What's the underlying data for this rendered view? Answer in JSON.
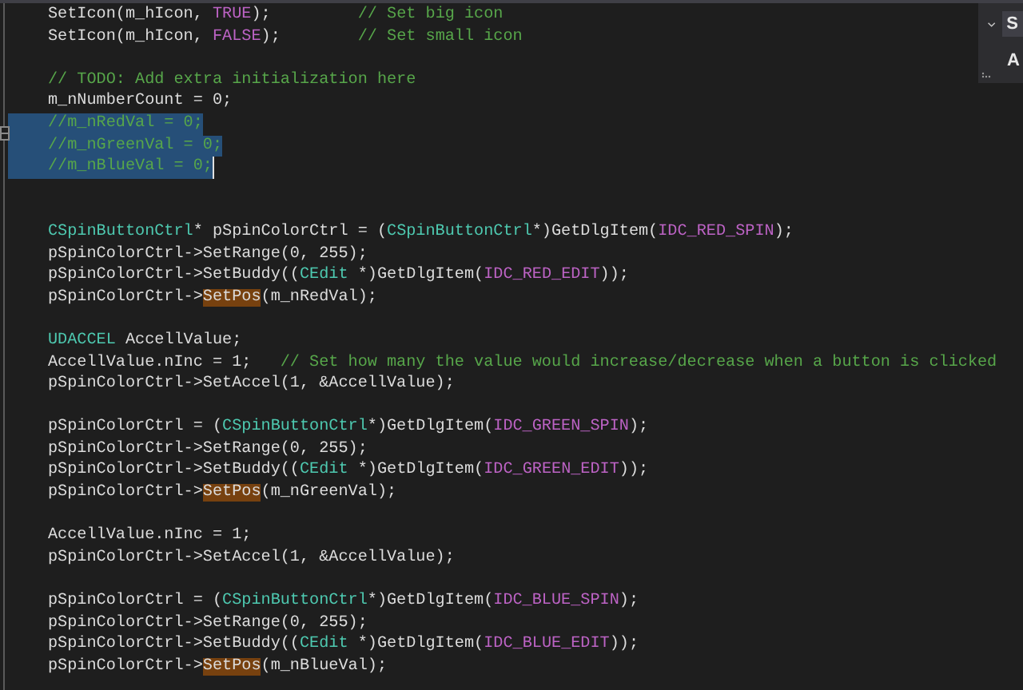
{
  "editor": {
    "lines": [
      {
        "selected": false,
        "caret": false,
        "tokens": [
          {
            "text": "SetIcon(m_hIcon, ",
            "kind": "plain"
          },
          {
            "text": "TRUE",
            "kind": "macro"
          },
          {
            "text": ");         ",
            "kind": "plain"
          },
          {
            "text": "// Set big icon",
            "kind": "comment"
          }
        ]
      },
      {
        "selected": false,
        "caret": false,
        "tokens": [
          {
            "text": "SetIcon(m_hIcon, ",
            "kind": "plain"
          },
          {
            "text": "FALSE",
            "kind": "macro"
          },
          {
            "text": ");        ",
            "kind": "plain"
          },
          {
            "text": "// Set small icon",
            "kind": "comment"
          }
        ]
      },
      {
        "selected": false,
        "caret": false
      },
      {
        "selected": false,
        "caret": false,
        "tokens": [
          {
            "text": "// TODO: Add extra initialization here",
            "kind": "comment"
          }
        ]
      },
      {
        "selected": false,
        "caret": false,
        "tokens": [
          {
            "text": "m_nNumberCount = 0;",
            "kind": "plain"
          }
        ]
      },
      {
        "selected": true,
        "caret": false,
        "tokens": [
          {
            "text": "//m_nRedVal = 0;",
            "kind": "comment"
          }
        ]
      },
      {
        "selected": true,
        "caret": false,
        "tokens": [
          {
            "text": "//m_nGreenVal = 0;",
            "kind": "comment"
          }
        ]
      },
      {
        "selected": true,
        "caret": true,
        "tokens": [
          {
            "text": "//m_nBlueVal = 0;",
            "kind": "comment"
          }
        ]
      },
      {
        "selected": false,
        "caret": false
      },
      {
        "selected": false,
        "caret": false
      },
      {
        "selected": false,
        "caret": false,
        "tokens": [
          {
            "text": "CSpinButtonCtrl",
            "kind": "type"
          },
          {
            "text": "* pSpinColorCtrl = (",
            "kind": "plain"
          },
          {
            "text": "CSpinButtonCtrl",
            "kind": "type"
          },
          {
            "text": "*)GetDlgItem(",
            "kind": "plain"
          },
          {
            "text": "IDC_RED_SPIN",
            "kind": "macro"
          },
          {
            "text": ");",
            "kind": "plain"
          }
        ]
      },
      {
        "selected": false,
        "caret": false,
        "tokens": [
          {
            "text": "pSpinColorCtrl->SetRange(0, 255);",
            "kind": "plain"
          }
        ]
      },
      {
        "selected": false,
        "caret": false,
        "tokens": [
          {
            "text": "pSpinColorCtrl->SetBuddy((",
            "kind": "plain"
          },
          {
            "text": "CEdit",
            "kind": "type"
          },
          {
            "text": " *)GetDlgItem(",
            "kind": "plain"
          },
          {
            "text": "IDC_RED_EDIT",
            "kind": "macro"
          },
          {
            "text": "));",
            "kind": "plain"
          }
        ]
      },
      {
        "selected": false,
        "caret": false,
        "tokens": [
          {
            "text": "pSpinColorCtrl->",
            "kind": "plain"
          },
          {
            "text": "SetPos",
            "kind": "ref"
          },
          {
            "text": "(m_nRedVal);",
            "kind": "plain"
          }
        ]
      },
      {
        "selected": false,
        "caret": false
      },
      {
        "selected": false,
        "caret": false,
        "tokens": [
          {
            "text": "UDACCEL",
            "kind": "type"
          },
          {
            "text": " AccellValue;",
            "kind": "plain"
          }
        ]
      },
      {
        "selected": false,
        "caret": false,
        "tokens": [
          {
            "text": "AccellValue.nInc = 1;   ",
            "kind": "plain"
          },
          {
            "text": "// Set how many the value would increase/decrease when a button is clicked",
            "kind": "comment"
          }
        ]
      },
      {
        "selected": false,
        "caret": false,
        "tokens": [
          {
            "text": "pSpinColorCtrl->SetAccel(1, &AccellValue);",
            "kind": "plain"
          }
        ]
      },
      {
        "selected": false,
        "caret": false
      },
      {
        "selected": false,
        "caret": false,
        "tokens": [
          {
            "text": "pSpinColorCtrl = (",
            "kind": "plain"
          },
          {
            "text": "CSpinButtonCtrl",
            "kind": "type"
          },
          {
            "text": "*)GetDlgItem(",
            "kind": "plain"
          },
          {
            "text": "IDC_GREEN_SPIN",
            "kind": "macro"
          },
          {
            "text": ");",
            "kind": "plain"
          }
        ]
      },
      {
        "selected": false,
        "caret": false,
        "tokens": [
          {
            "text": "pSpinColorCtrl->SetRange(0, 255);",
            "kind": "plain"
          }
        ]
      },
      {
        "selected": false,
        "caret": false,
        "tokens": [
          {
            "text": "pSpinColorCtrl->SetBuddy((",
            "kind": "plain"
          },
          {
            "text": "CEdit",
            "kind": "type"
          },
          {
            "text": " *)GetDlgItem(",
            "kind": "plain"
          },
          {
            "text": "IDC_GREEN_EDIT",
            "kind": "macro"
          },
          {
            "text": "));",
            "kind": "plain"
          }
        ]
      },
      {
        "selected": false,
        "caret": false,
        "tokens": [
          {
            "text": "pSpinColorCtrl->",
            "kind": "plain"
          },
          {
            "text": "SetPos",
            "kind": "ref"
          },
          {
            "text": "(m_nGreenVal);",
            "kind": "plain"
          }
        ]
      },
      {
        "selected": false,
        "caret": false
      },
      {
        "selected": false,
        "caret": false,
        "tokens": [
          {
            "text": "AccellValue.nInc = 1;",
            "kind": "plain"
          }
        ]
      },
      {
        "selected": false,
        "caret": false,
        "tokens": [
          {
            "text": "pSpinColorCtrl->SetAccel(1, &AccellValue);",
            "kind": "plain"
          }
        ]
      },
      {
        "selected": false,
        "caret": false
      },
      {
        "selected": false,
        "caret": false,
        "tokens": [
          {
            "text": "pSpinColorCtrl = (",
            "kind": "plain"
          },
          {
            "text": "CSpinButtonCtrl",
            "kind": "type"
          },
          {
            "text": "*)GetDlgItem(",
            "kind": "plain"
          },
          {
            "text": "IDC_BLUE_SPIN",
            "kind": "macro"
          },
          {
            "text": ");",
            "kind": "plain"
          }
        ]
      },
      {
        "selected": false,
        "caret": false,
        "tokens": [
          {
            "text": "pSpinColorCtrl->SetRange(0, 255);",
            "kind": "plain"
          }
        ]
      },
      {
        "selected": false,
        "caret": false,
        "tokens": [
          {
            "text": "pSpinColorCtrl->SetBuddy((",
            "kind": "plain"
          },
          {
            "text": "CEdit",
            "kind": "type"
          },
          {
            "text": " *)GetDlgItem(",
            "kind": "plain"
          },
          {
            "text": "IDC_BLUE_EDIT",
            "kind": "macro"
          },
          {
            "text": "));",
            "kind": "plain"
          }
        ]
      },
      {
        "selected": false,
        "caret": false,
        "tokens": [
          {
            "text": "pSpinColorCtrl->",
            "kind": "plain"
          },
          {
            "text": "SetPos",
            "kind": "ref"
          },
          {
            "text": "(m_nBlueVal);",
            "kind": "plain"
          }
        ]
      }
    ]
  },
  "popup": {
    "items": [
      "S",
      "A"
    ]
  }
}
